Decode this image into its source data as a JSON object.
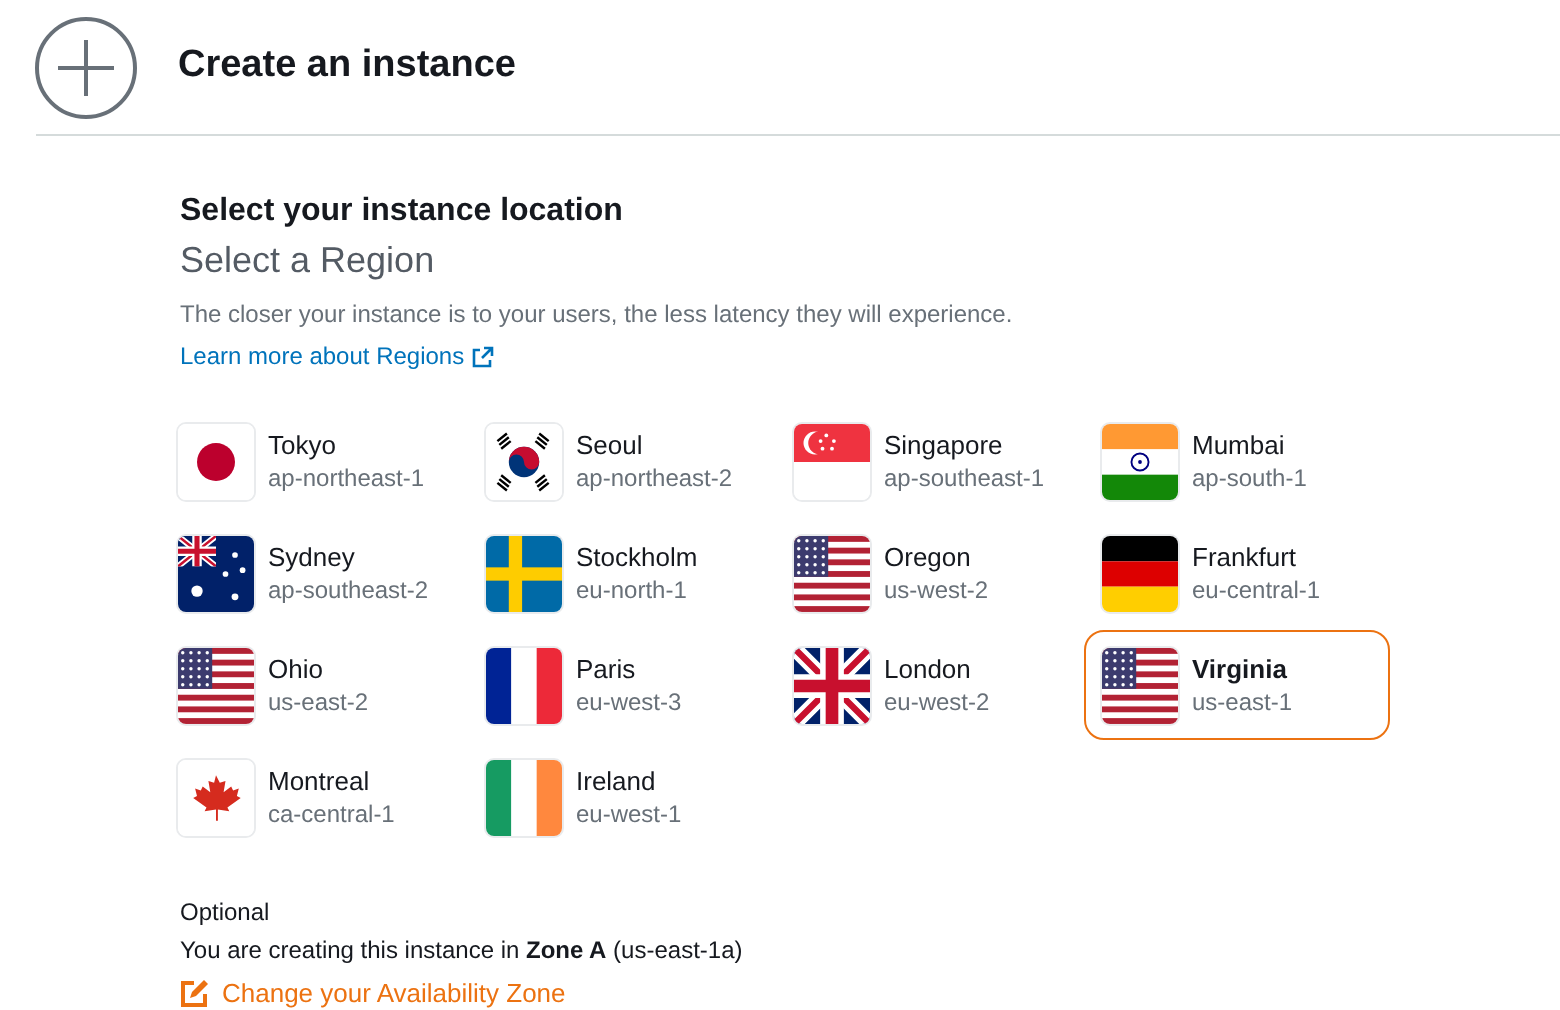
{
  "header": {
    "title": "Create an instance"
  },
  "location": {
    "heading": "Select your instance location",
    "subheading": "Select a Region",
    "description": "The closer your instance is to your users, the less latency they will experience.",
    "link": "Learn more about Regions"
  },
  "regions": [
    {
      "name": "Tokyo",
      "code": "ap-northeast-1",
      "kind": "jp",
      "selected": false
    },
    {
      "name": "Seoul",
      "code": "ap-northeast-2",
      "kind": "kr",
      "selected": false
    },
    {
      "name": "Singapore",
      "code": "ap-southeast-1",
      "kind": "sg",
      "selected": false
    },
    {
      "name": "Mumbai",
      "code": "ap-south-1",
      "kind": "in",
      "selected": false
    },
    {
      "name": "Sydney",
      "code": "ap-southeast-2",
      "kind": "au",
      "selected": false
    },
    {
      "name": "Stockholm",
      "code": "eu-north-1",
      "kind": "se",
      "selected": false
    },
    {
      "name": "Oregon",
      "code": "us-west-2",
      "kind": "us",
      "selected": false
    },
    {
      "name": "Frankfurt",
      "code": "eu-central-1",
      "kind": "de",
      "selected": false
    },
    {
      "name": "Ohio",
      "code": "us-east-2",
      "kind": "us",
      "selected": false
    },
    {
      "name": "Paris",
      "code": "eu-west-3",
      "kind": "fr",
      "selected": false
    },
    {
      "name": "London",
      "code": "eu-west-2",
      "kind": "gb",
      "selected": false
    },
    {
      "name": "Virginia",
      "code": "us-east-1",
      "kind": "us",
      "selected": true
    },
    {
      "name": "Montreal",
      "code": "ca-central-1",
      "kind": "ca",
      "selected": false
    },
    {
      "name": "Ireland",
      "code": "eu-west-1",
      "kind": "ie",
      "selected": false
    }
  ],
  "zone": {
    "label": "Optional",
    "text": "You are creating this instance in **Zone A** (us-east-1a)",
    "link": "Change your Availability Zone"
  }
}
